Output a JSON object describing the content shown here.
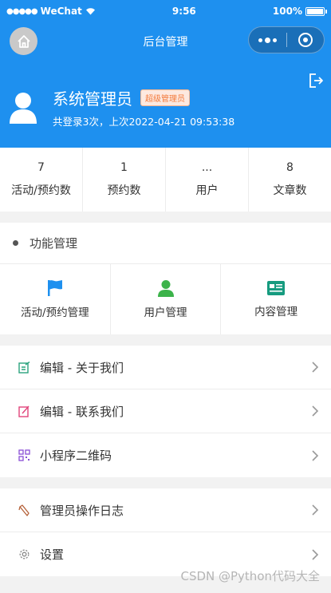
{
  "statusbar": {
    "carrier": "WeChat",
    "time": "9:56",
    "battery": "100%"
  },
  "navbar": {
    "title": "后台管理"
  },
  "profile": {
    "name": "系统管理员",
    "badge": "超级管理员",
    "login_info": "共登录3次，上次2022-04-21 09:53:38"
  },
  "stats": [
    {
      "value": "7",
      "label": "活动/预约数"
    },
    {
      "value": "1",
      "label": "预约数"
    },
    {
      "value": "...",
      "label": "用户"
    },
    {
      "value": "8",
      "label": "文章数"
    }
  ],
  "function_section": {
    "title": "功能管理",
    "items": [
      {
        "label": "活动/预约管理",
        "icon": "flag-icon",
        "color": "#1e90ef"
      },
      {
        "label": "用户管理",
        "icon": "user-icon",
        "color": "#3cb34a"
      },
      {
        "label": "内容管理",
        "icon": "content-icon",
        "color": "#169b7f"
      }
    ]
  },
  "menu_group_1": [
    {
      "label": "编辑 - 关于我们",
      "icon": "edit-icon",
      "color": "#2aa37d"
    },
    {
      "label": "编辑 - 联系我们",
      "icon": "edit-icon",
      "color": "#e0457b"
    },
    {
      "label": "小程序二维码",
      "icon": "qrcode-icon",
      "color": "#8a4fd6"
    }
  ],
  "menu_group_2": [
    {
      "label": "管理员操作日志",
      "icon": "log-icon",
      "color": "#b5623a"
    },
    {
      "label": "设置",
      "icon": "gear-icon",
      "color": "#888888"
    }
  ],
  "watermark": "CSDN @Python代码大全",
  "colors": {
    "primary": "#1e90ef",
    "badge_text": "#f37b3d"
  }
}
